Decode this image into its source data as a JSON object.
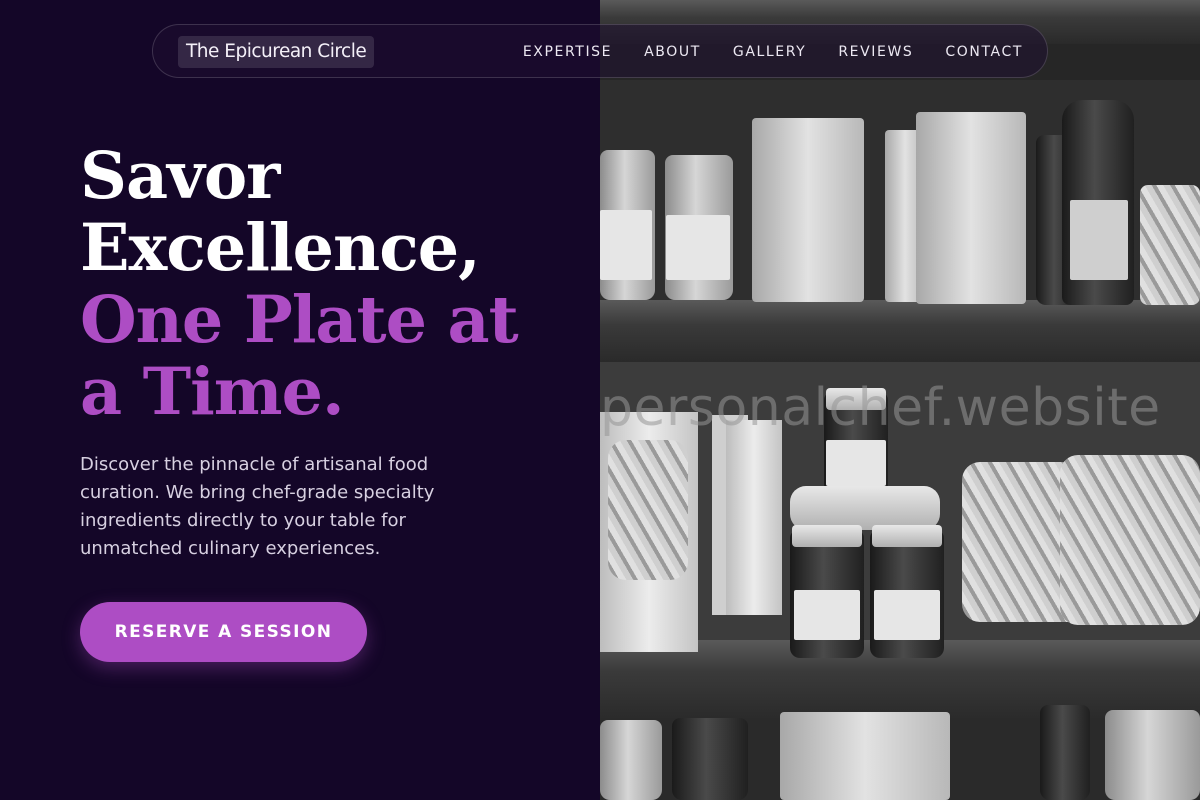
{
  "navbar": {
    "brand": "The Epicurean Circle",
    "links": [
      "EXPERTISE",
      "ABOUT",
      "GALLERY",
      "REVIEWS",
      "CONTACT"
    ]
  },
  "hero": {
    "line1": "Savor",
    "line2": "Excellence,",
    "line3": "One Plate at",
    "line4": "a Time.",
    "description": "Discover the pinnacle of artisanal food curation. We bring chef-grade specialty ingredients directly to your table for unmatched culinary experiences.",
    "cta_label": "RESERVE A SESSION"
  },
  "image": {
    "watermark": "personalchef.website"
  },
  "colors": {
    "background": "#140628",
    "accent": "#ad4dc4",
    "text": "#ffffff",
    "muted_text": "#d7d0e1"
  }
}
